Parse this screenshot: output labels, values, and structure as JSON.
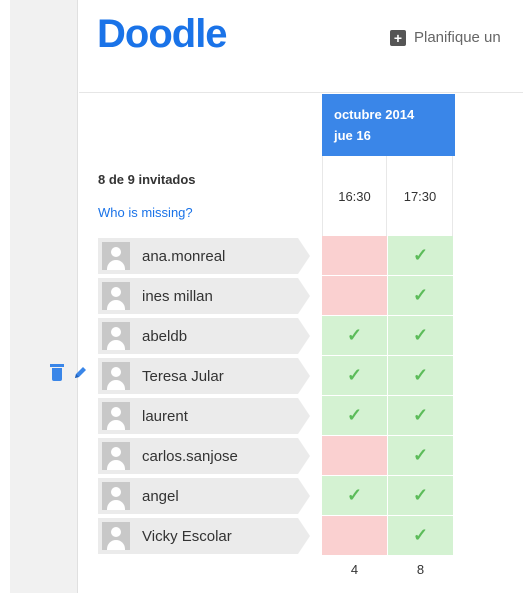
{
  "header": {
    "logo": "Doodle",
    "plan_label": "Planifique un"
  },
  "date_column": {
    "month": "octubre 2014",
    "day": "jue 16"
  },
  "summary": {
    "guests": "8 de 9 invitados",
    "missing_link": "Who is missing?"
  },
  "time_slots": [
    "16:30",
    "17:30"
  ],
  "participants": [
    {
      "name": "ana.monreal",
      "votes": [
        "no",
        "yes"
      ]
    },
    {
      "name": "ines millan",
      "votes": [
        "no",
        "yes"
      ]
    },
    {
      "name": "abeldb",
      "votes": [
        "yes",
        "yes"
      ]
    },
    {
      "name": "Teresa Jular",
      "votes": [
        "yes",
        "yes"
      ]
    },
    {
      "name": "laurent",
      "votes": [
        "yes",
        "yes"
      ]
    },
    {
      "name": "carlos.sanjose",
      "votes": [
        "no",
        "yes"
      ]
    },
    {
      "name": "angel",
      "votes": [
        "yes",
        "yes"
      ]
    },
    {
      "name": "Vicky Escolar",
      "votes": [
        "no",
        "yes"
      ]
    }
  ],
  "check_glyph": "✓",
  "totals": [
    "4",
    "8"
  ],
  "colors": {
    "brand": "#1a73e8",
    "date_header": "#3a86e8",
    "yes_bg": "#d4f2d2",
    "no_bg": "#fad0d0",
    "check": "#5cbc5a"
  },
  "icons": [
    "plus-icon",
    "user-avatar-icon",
    "trash-icon",
    "pencil-icon",
    "check-icon"
  ]
}
